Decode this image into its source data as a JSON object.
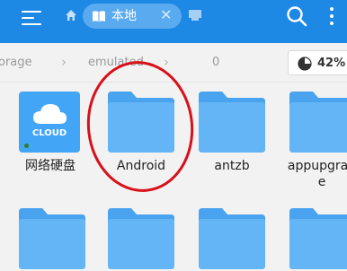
{
  "toolbar": {
    "tab_label": "本地",
    "tab_close": "✕",
    "icons": [
      "menu-icon",
      "home-icon",
      "book-icon",
      "close-icon",
      "windows-icon",
      "search-icon",
      "more-vertical-icon"
    ]
  },
  "breadcrumb": {
    "items": [
      "orage",
      "emulated",
      "0"
    ],
    "separator": "›"
  },
  "storage": {
    "percent_label": "42%"
  },
  "grid": {
    "items": [
      {
        "label": "网络硬盘",
        "type": "cloud",
        "badge": "CLOUD"
      },
      {
        "label": "Android",
        "type": "folder"
      },
      {
        "label": "antzb",
        "type": "folder"
      },
      {
        "label": "appupgrad\ne",
        "type": "folder"
      }
    ]
  },
  "colors": {
    "toolbar": "#1e88e5",
    "tab": "#5aaaf0",
    "folder": "#64b5f6",
    "folder_dark": "#4aa3ee",
    "highlight_circle": "#d8101a"
  }
}
